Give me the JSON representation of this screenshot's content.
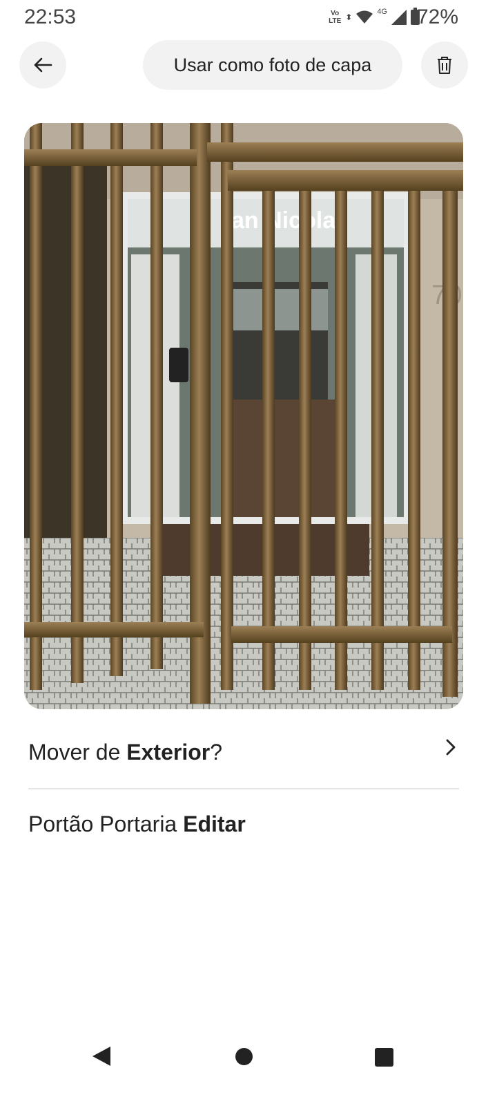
{
  "status_bar": {
    "time": "22:53",
    "volte_top": "Vo",
    "volte_bottom": "LTE",
    "network_type": "4G",
    "battery_percent": "72%",
    "icons": [
      "volte-icon",
      "data-arrows-icon",
      "wifi-icon",
      "signal-icon",
      "battery-icon"
    ]
  },
  "toolbar": {
    "back_icon": "arrow-left-icon",
    "cover_button_label": "Usar como foto de capa",
    "delete_icon": "trash-icon"
  },
  "photo": {
    "sign_text": "an Nicola",
    "number_text": "70"
  },
  "move_row": {
    "prefix": "Mover de ",
    "room": "Exterior",
    "suffix": "?",
    "chevron_icon": "chevron-right-icon"
  },
  "caption_row": {
    "caption": "Portão Portaria ",
    "edit_label": "Editar"
  },
  "nav_bar": {
    "icons": [
      "nav-back-icon",
      "nav-home-icon",
      "nav-recents-icon"
    ]
  }
}
